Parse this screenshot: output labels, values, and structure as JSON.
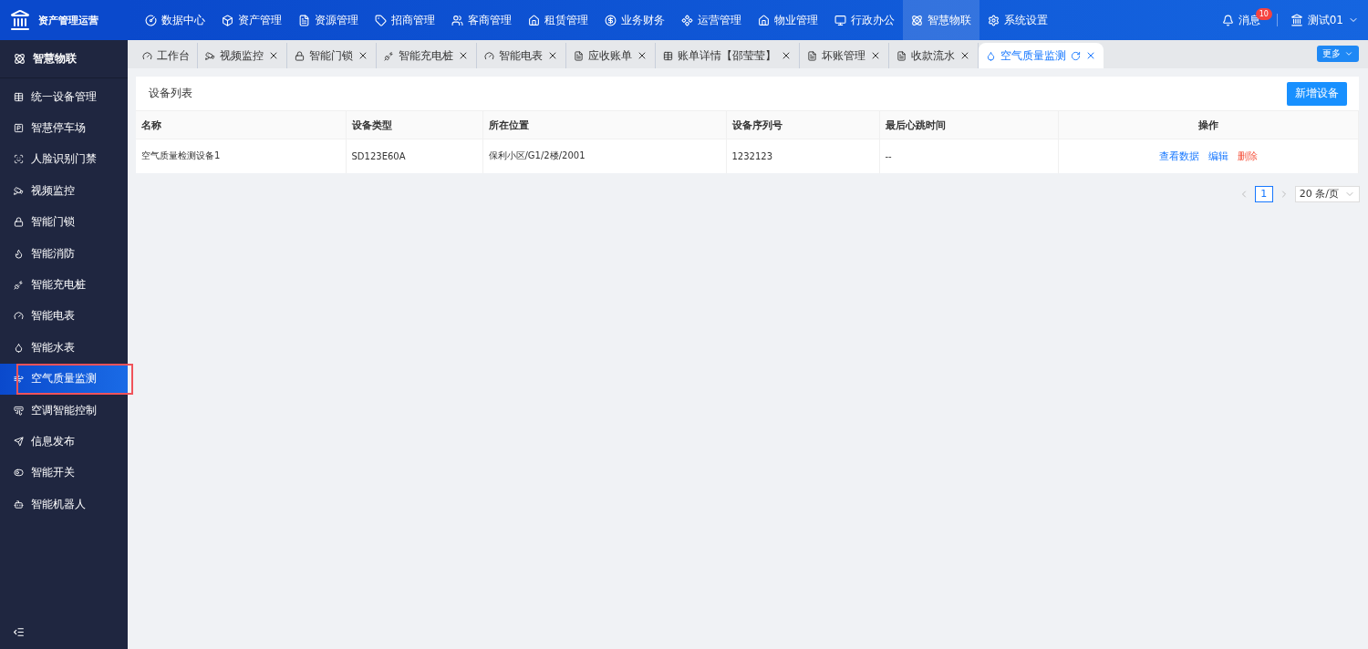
{
  "app": {
    "title": "资产管理运营"
  },
  "top_nav": [
    {
      "label": "数据中心",
      "selected": false
    },
    {
      "label": "资产管理",
      "selected": false
    },
    {
      "label": "资源管理",
      "selected": false
    },
    {
      "label": "招商管理",
      "selected": false
    },
    {
      "label": "客商管理",
      "selected": false
    },
    {
      "label": "租赁管理",
      "selected": false
    },
    {
      "label": "业务财务",
      "selected": false
    },
    {
      "label": "运营管理",
      "selected": false
    },
    {
      "label": "物业管理",
      "selected": false
    },
    {
      "label": "行政办公",
      "selected": false
    },
    {
      "label": "智慧物联",
      "selected": true
    },
    {
      "label": "系统设置",
      "selected": false
    }
  ],
  "header_right": {
    "messages": {
      "label": "消息",
      "badge": "10"
    },
    "user": "测试01"
  },
  "sidebar": {
    "title": "智慧物联",
    "items": [
      {
        "label": "统一设备管理",
        "selected": false
      },
      {
        "label": "智慧停车场",
        "selected": false
      },
      {
        "label": "人脸识别门禁",
        "selected": false
      },
      {
        "label": "视频监控",
        "selected": false
      },
      {
        "label": "智能门锁",
        "selected": false
      },
      {
        "label": "智能消防",
        "selected": false
      },
      {
        "label": "智能充电桩",
        "selected": false
      },
      {
        "label": "智能电表",
        "selected": false
      },
      {
        "label": "智能水表",
        "selected": false
      },
      {
        "label": "空气质量监测",
        "selected": true,
        "annotated": true
      },
      {
        "label": "空调智能控制",
        "selected": false
      },
      {
        "label": "信息发布",
        "selected": false
      },
      {
        "label": "智能开关",
        "selected": false
      },
      {
        "label": "智能机器人",
        "selected": false
      }
    ]
  },
  "tabs": [
    {
      "label": "工作台",
      "selected": false,
      "closable": false
    },
    {
      "label": "视频监控",
      "selected": false,
      "closable": true
    },
    {
      "label": "智能门锁",
      "selected": false,
      "closable": true
    },
    {
      "label": "智能充电桩",
      "selected": false,
      "closable": true
    },
    {
      "label": "智能电表",
      "selected": false,
      "closable": true
    },
    {
      "label": "应收账单",
      "selected": false,
      "closable": true
    },
    {
      "label": "账单详情【邵莹莹】",
      "selected": false,
      "closable": true
    },
    {
      "label": "坏账管理",
      "selected": false,
      "closable": true
    },
    {
      "label": "收款流水",
      "selected": false,
      "closable": true
    },
    {
      "label": "空气质量监测",
      "selected": true,
      "closable": true
    }
  ],
  "more_button": "更多",
  "panel": {
    "title": "设备列表",
    "add_button": "新增设备"
  },
  "table": {
    "columns": [
      "名称",
      "设备类型",
      "所在位置",
      "设备序列号",
      "最后心跳时间",
      "操作"
    ],
    "rows": [
      {
        "cells": [
          "空气质量检测设备1",
          "SD123E60A",
          "保利小区/G1/2楼/2001",
          "1232123",
          "--"
        ],
        "actions": [
          {
            "label": "查看数据",
            "kind": "normal"
          },
          {
            "label": "编辑",
            "kind": "normal"
          },
          {
            "label": "删除",
            "kind": "danger"
          }
        ]
      }
    ]
  },
  "pagination": {
    "pages": [
      {
        "label": "1",
        "selected": true
      }
    ],
    "page_size": "20 条/页"
  }
}
